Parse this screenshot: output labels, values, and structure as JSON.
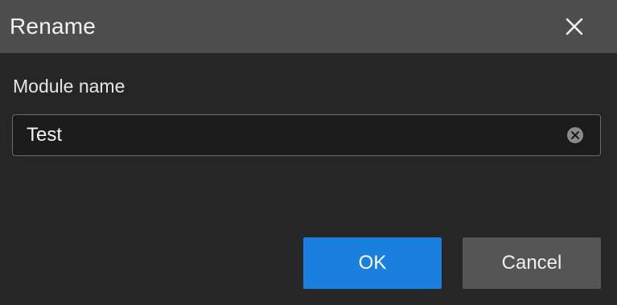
{
  "dialog": {
    "title": "Rename",
    "close_icon": "close-icon"
  },
  "form": {
    "label": "Module name",
    "value": "Test",
    "clear_icon": "clear-circle-icon"
  },
  "buttons": {
    "ok_label": "OK",
    "cancel_label": "Cancel"
  },
  "colors": {
    "titlebar": "#4d4d4d",
    "background": "#262626",
    "primary": "#1a80e0",
    "secondary": "#555555"
  }
}
